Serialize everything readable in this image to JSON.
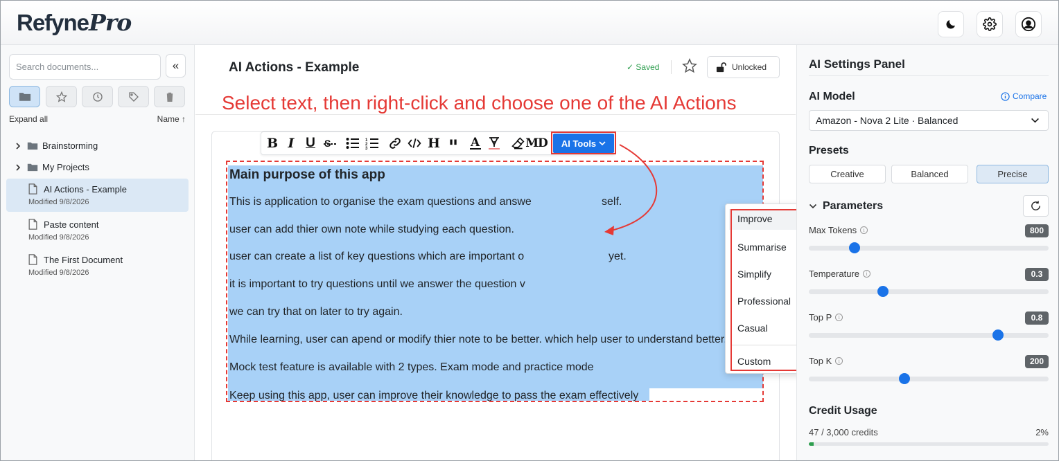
{
  "app": {
    "logo_main": "Refyne",
    "logo_pro": "Pro"
  },
  "sidebar": {
    "search_placeholder": "Search documents...",
    "collapse_glyph": "«",
    "expand_all": "Expand all",
    "sort_label": "Name ↑",
    "folders": [
      {
        "label": "Brainstorming"
      },
      {
        "label": "My Projects"
      }
    ],
    "documents": [
      {
        "title": "AI Actions - Example",
        "modified": "Modified 9/8/2026"
      },
      {
        "title": "Paste content",
        "modified": "Modified 9/8/2026"
      },
      {
        "title": "The First Document",
        "modified": "Modified 9/8/2026"
      }
    ]
  },
  "editor": {
    "doc_title": "AI Actions - Example",
    "saved_label": "✓ Saved",
    "lock_label": "Unlocked",
    "annotation": "Select text, then right-click and choose one of the AI Actions",
    "ai_tools_label": "AI Tools",
    "heading": "Main purpose of this app",
    "lines": [
      "This is application to organise the exam questions and answe",
      "user can add thier own note while studying each question.",
      "user can create a list of key questions which are important o",
      "it is important to try questions until we answer the question v",
      "we can try that on later to try again.",
      "While learning, user can apend or modify thier note to be better. which help user to understand better.",
      "Mock test feature is available with 2 types. Exam mode and practice mode",
      "Keep using this app, user can improve their knowledge to pass the exam effectively"
    ],
    "line_tails": [
      "self.",
      "yet."
    ],
    "menu": [
      "Improve",
      "Summarise",
      "Simplify",
      "Professional",
      "Casual",
      "Custom"
    ],
    "accent_color": "#1a73e8",
    "annotation_color": "#e53935",
    "selection_color": "#a8d1f7"
  },
  "panel": {
    "title": "AI Settings Panel",
    "model_heading": "AI Model",
    "compare_label": "Compare",
    "model_value": "Amazon - Nova 2 Lite · Balanced",
    "presets_heading": "Presets",
    "presets": [
      "Creative",
      "Balanced",
      "Precise"
    ],
    "active_preset": "Precise",
    "parameters_heading": "Parameters",
    "params": [
      {
        "label": "Max Tokens",
        "value": "800",
        "fraction": 0.19
      },
      {
        "label": "Temperature",
        "value": "0.3",
        "fraction": 0.31
      },
      {
        "label": "Top P",
        "value": "0.8",
        "fraction": 0.79
      },
      {
        "label": "Top K",
        "value": "200",
        "fraction": 0.4
      }
    ],
    "credit_heading": "Credit Usage",
    "credit_text": "47 / 3,000 credits",
    "credit_pct": "2%",
    "credit_fraction": 0.02
  }
}
